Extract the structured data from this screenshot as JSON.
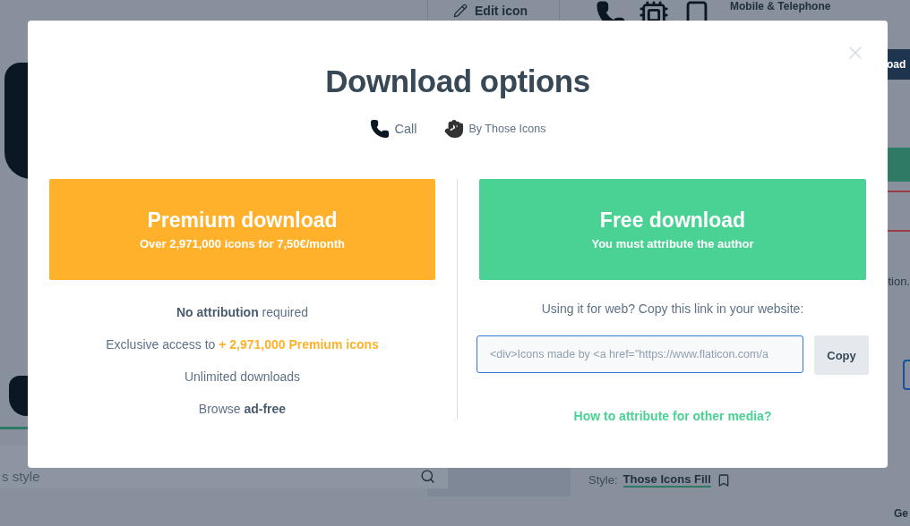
{
  "background": {
    "edit_button": "Edit icon",
    "category_title": "Mobile & Telephone",
    "download_button": "oad",
    "note": "tion.",
    "search": {
      "placeholder": "s style"
    },
    "style": {
      "label": "Style:",
      "value": "Those Icons Fill"
    },
    "footer_text": "Ge"
  },
  "modal": {
    "title": "Download options",
    "meta": [
      {
        "kind": "phone",
        "text": "Call"
      },
      {
        "kind": "author",
        "text": "By Those Icons"
      }
    ],
    "premium": {
      "title": "Premium download",
      "subtitle": "Over 2,971,000 icons for 7,50€/month",
      "features": [
        {
          "text": "**No attribution** required"
        },
        {
          "text": "Exclusive access to",
          "highlight": "+ 2,971,000 Premium icons"
        },
        {
          "text": "Unlimited downloads"
        },
        {
          "text": "Browse **ad-free**"
        }
      ]
    },
    "free": {
      "title": "Free download",
      "subtitle": "You must attribute the author",
      "prompt": "Using it for web? Copy this link in your website:",
      "embed_code": "<div>Icons made by <a href=\"https://www.flaticon.com/a",
      "copy_button": "Copy",
      "link": "How to attribute for other media?"
    }
  }
}
